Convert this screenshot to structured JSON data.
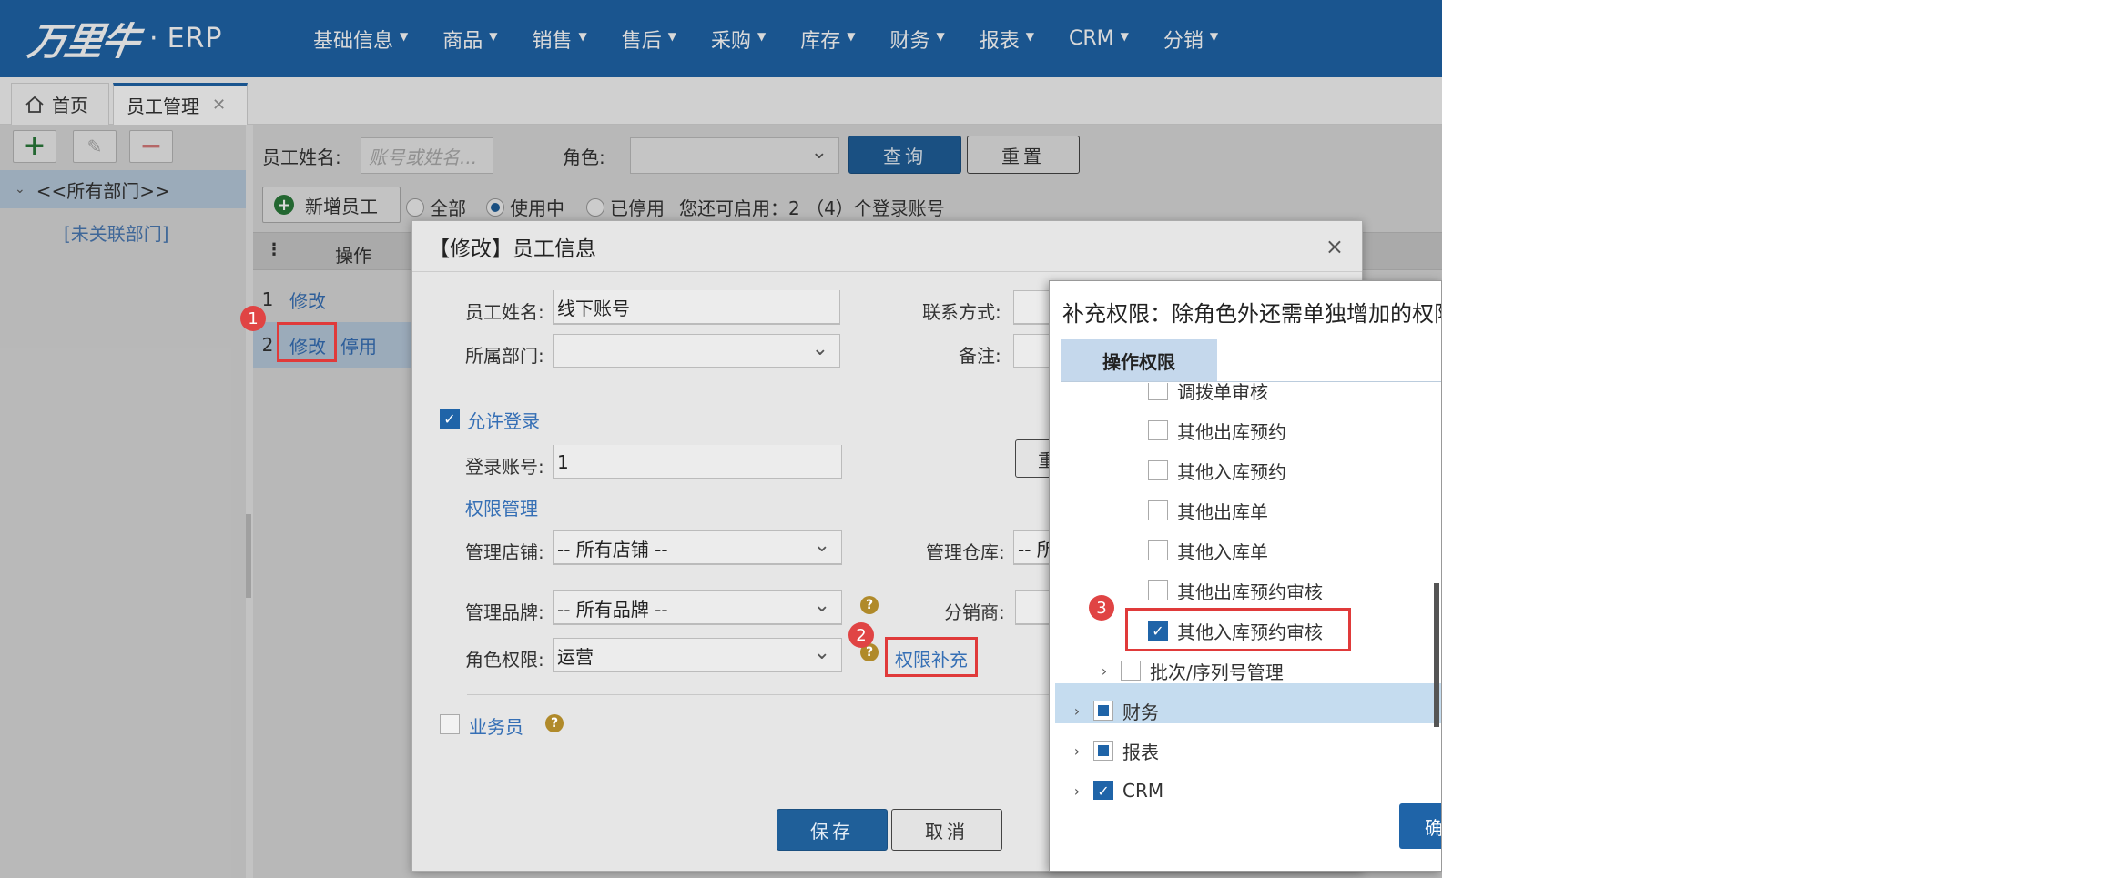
{
  "header": {
    "logo": "万里牛",
    "logo_sep": "·",
    "product": "ERP",
    "nav": [
      "基础信息",
      "商品",
      "销售",
      "售后",
      "采购",
      "库存",
      "财务",
      "报表",
      "CRM",
      "分销"
    ]
  },
  "tabs": {
    "home": "首页",
    "active": "员工管理"
  },
  "sidebar": {
    "root": "<<所有部门>>",
    "child": "[未关联部门]"
  },
  "search": {
    "name_label": "员工姓名:",
    "name_placeholder": "账号或姓名...",
    "role_label": "角色:",
    "query": "查询",
    "reset": "重置",
    "add_employee": "新增员工",
    "filters": [
      "全部",
      "使用中",
      "已停用"
    ],
    "quota": "您还可启用：2 （4）个登录账号"
  },
  "grid": {
    "col_action": "操作",
    "rows": [
      {
        "num": "1",
        "edit": "修改"
      },
      {
        "num": "2",
        "edit": "修改",
        "disable": "停用"
      }
    ]
  },
  "modal": {
    "title": "【修改】员工信息",
    "close": "×",
    "name_label": "员工姓名:",
    "name_value": "线下账号",
    "contact_label": "联系方式:",
    "dept_label": "所属部门:",
    "remark_label": "备注:",
    "allow_login": "允许登录",
    "account_label": "登录账号:",
    "account_value": "1",
    "perm_section": "权限管理",
    "store_label": "管理店铺:",
    "store_value": "-- 所有店铺 --",
    "warehouse_label": "管理仓库:",
    "warehouse_value": "-- 所",
    "brand_label": "管理品牌:",
    "brand_value": "-- 所有品牌 --",
    "distributor_label": "分销商:",
    "role_label": "角色权限:",
    "role_value": "运营",
    "perm_supplement": "权限补充",
    "salesman": "业务员",
    "save": "保存",
    "cancel": "取消",
    "partial_button": "重"
  },
  "perm_panel": {
    "title": "补充权限：除角色外还需单独增加的权限",
    "tab": "操作权限",
    "nodes": [
      {
        "label": "调拨单审核",
        "checked": false
      },
      {
        "label": "其他出库预约",
        "checked": false
      },
      {
        "label": "其他入库预约",
        "checked": false
      },
      {
        "label": "其他出库单",
        "checked": false
      },
      {
        "label": "其他入库单",
        "checked": false
      },
      {
        "label": "其他出库预约审核",
        "checked": false
      },
      {
        "label": "其他入库预约审核",
        "checked": true
      },
      {
        "label": "批次/序列号管理",
        "checked": false
      },
      {
        "label": "财务",
        "checked": "partial"
      },
      {
        "label": "报表",
        "checked": "partial"
      },
      {
        "label": "CRM",
        "checked": true
      }
    ],
    "ok_partial": "确"
  },
  "badges": [
    "1",
    "2",
    "3"
  ],
  "colors": {
    "brand": "#1f64a8",
    "highlight": "#e03a3a",
    "link": "#356fb5"
  }
}
